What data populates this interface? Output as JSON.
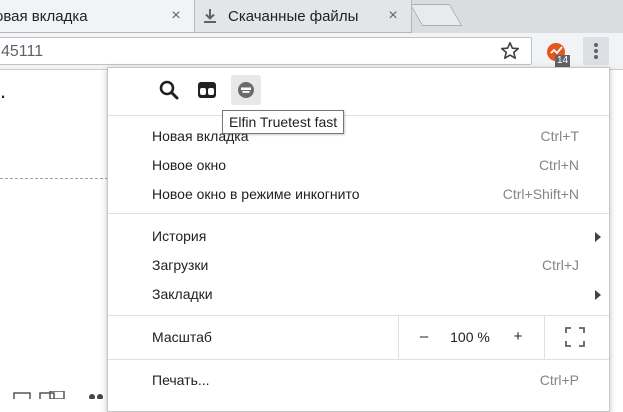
{
  "tabs": [
    {
      "title": "овая вкладка",
      "close_icon": "close-icon"
    },
    {
      "title": "Скачанные файлы",
      "icon": "download-icon",
      "close_icon": "close-icon"
    }
  ],
  "new_tab_icon": "new-tab-icon",
  "omnibox": {
    "url": "45111"
  },
  "toolbar": {
    "bookmark_icon": "star-icon",
    "extension_badge": "14",
    "menu_icon": "vertical-dots-icon"
  },
  "page": {
    "text": "."
  },
  "menu": {
    "extensions": [
      {
        "icon": "search-icon"
      },
      {
        "icon": "binoculars-icon"
      },
      {
        "icon": "elfin-icon"
      }
    ],
    "tooltip": "Elfin Truetest fast",
    "group1": [
      {
        "label": "Новая вкладка",
        "shortcut": "Ctrl+T"
      },
      {
        "label": "Новое окно",
        "shortcut": "Ctrl+N"
      },
      {
        "label": "Новое окно в режиме инкогнито",
        "shortcut": "Ctrl+Shift+N"
      }
    ],
    "group2": [
      {
        "label": "История",
        "shortcut": "",
        "has_submenu": true
      },
      {
        "label": "Загрузки",
        "shortcut": "Ctrl+J",
        "has_submenu": false
      },
      {
        "label": "Закладки",
        "shortcut": "",
        "has_submenu": true
      }
    ],
    "zoom": {
      "label": "Масштаб",
      "minus": "–",
      "value": "100 %",
      "plus": "+",
      "fullscreen_icon": "fullscreen-icon"
    },
    "print": {
      "label": "Печать...",
      "shortcut": "Ctrl+P"
    }
  },
  "colors": {
    "tab_strip": "#dadce0",
    "toolbar": "#f1f3f4",
    "extension_accent": "#e8541e",
    "shortcut_text": "#80868b"
  }
}
